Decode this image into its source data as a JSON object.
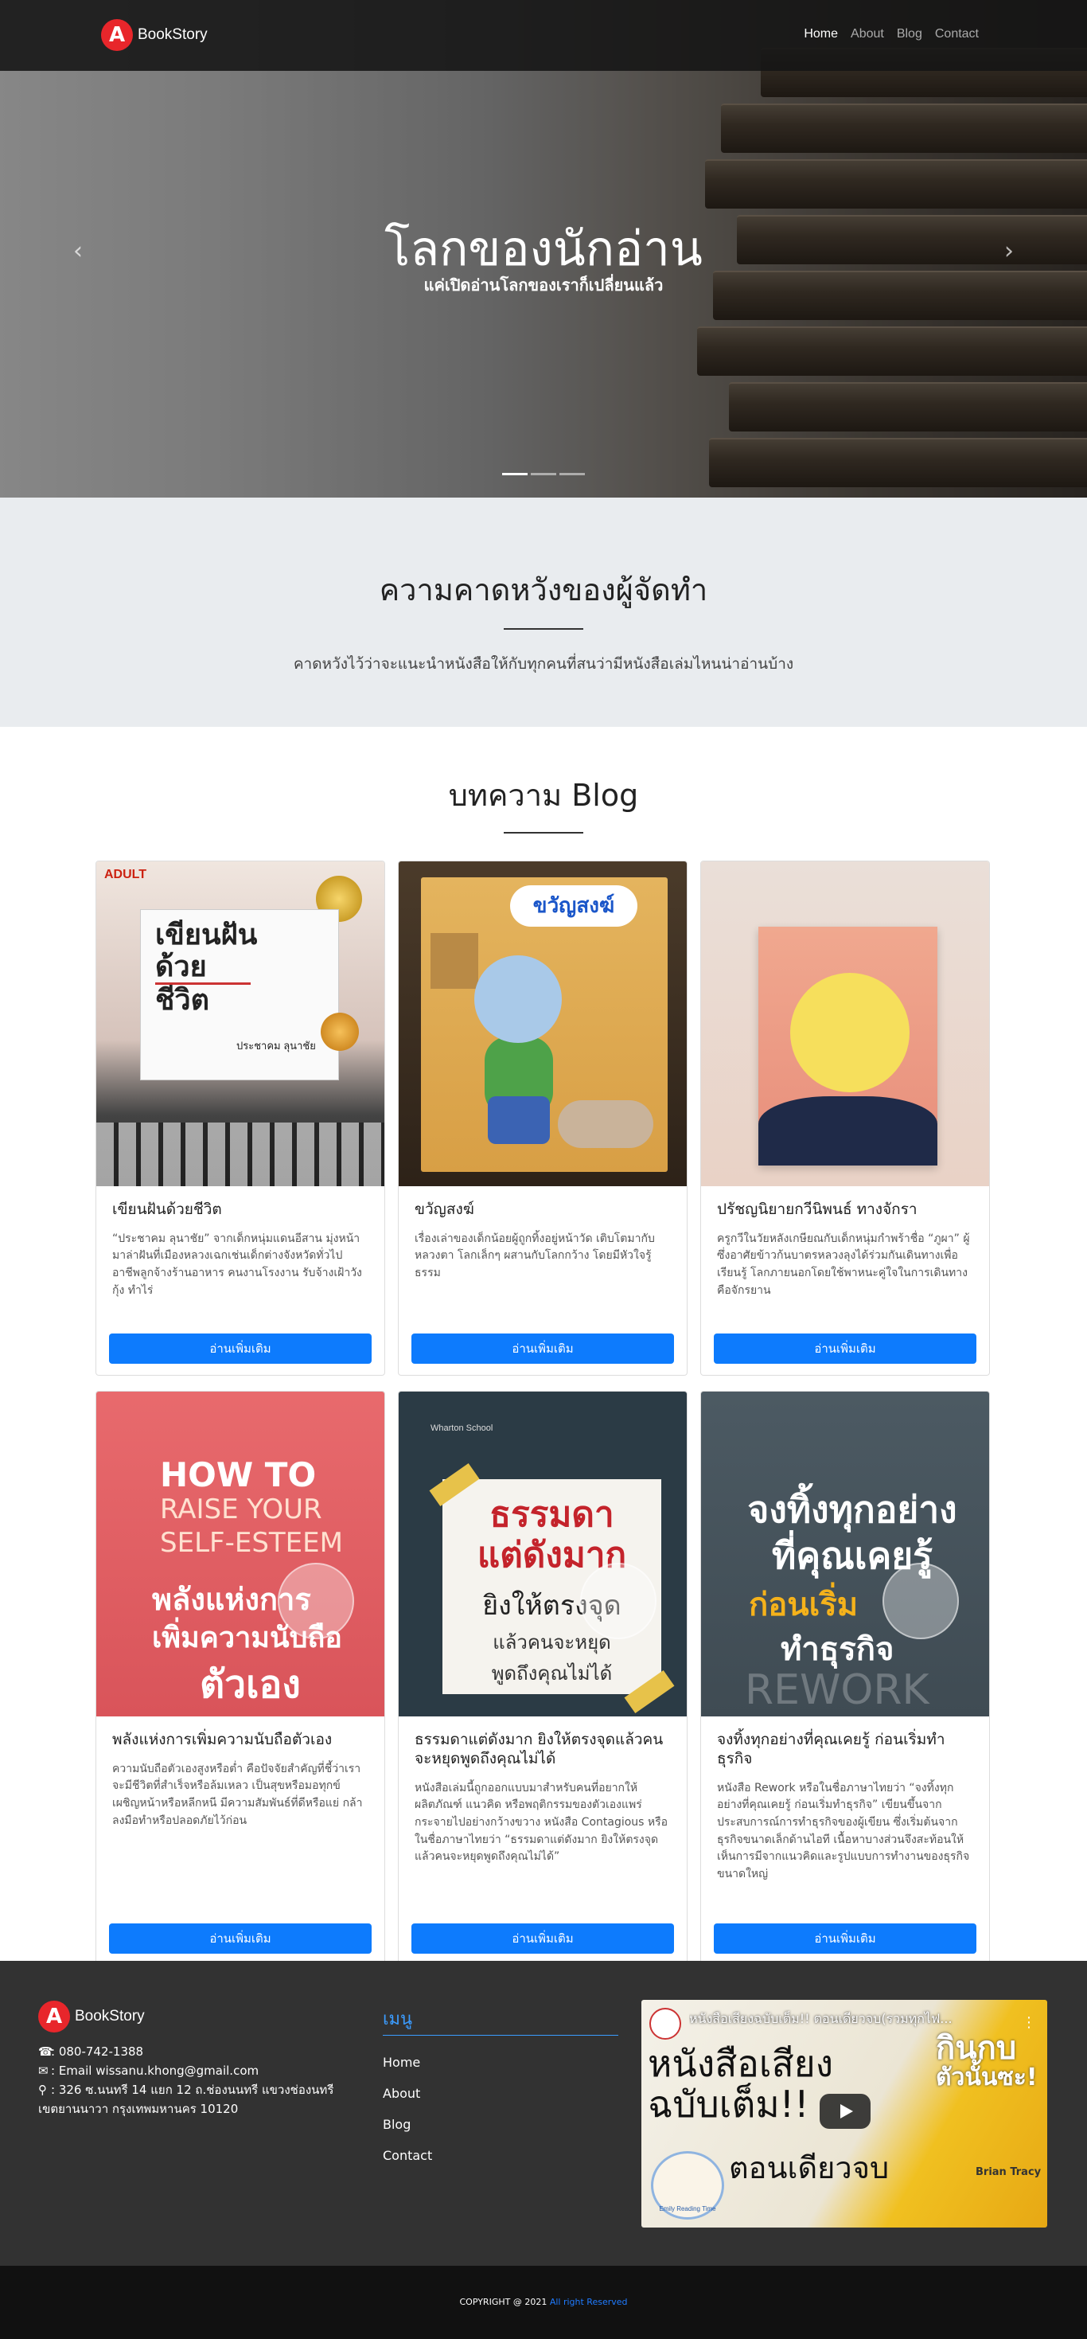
{
  "nav": {
    "brand_letter": "A",
    "brand": "BookStory",
    "links": [
      {
        "label": "Home",
        "active": true
      },
      {
        "label": "About",
        "active": false
      },
      {
        "label": "Blog",
        "active": false
      },
      {
        "label": "Contact",
        "active": false
      }
    ]
  },
  "hero": {
    "title": "โลกของนักอ่าน",
    "subtitle": "แค่เปิดอ่านโลกของเราก็เปลี่ยนแล้ว",
    "prev_icon": "‹",
    "next_icon": "›",
    "slide_count": 3,
    "active_slide": 1
  },
  "expect": {
    "title": "ความคาดหวังของผู้จัดทำ",
    "text": "คาดหวังไว้ว่าจะแนะนำหนังสือให้กับทุกคนที่สนว่ามีหนังสือเล่มไหนน่าอ่านบ้าง"
  },
  "blog": {
    "title": "บทความ Blog",
    "button_label": "อ่านเพิ่มเติม",
    "posts": [
      {
        "title": "เขียนฝันด้วยชีวิต",
        "text": "“ประชาคม ลุนาชัย” จากเด็กหนุ่มแดนอีสาน มุ่งหน้ามาล่าฝันที่เมืองหลวงเฉกเช่นเด็กต่างจังหวัดทั่วไป อาชีพลูกจ้างร้านอาหาร คนงานโรงงาน รับจ้างเฝ้าวังกุ้ง ทำไร่",
        "cover": {
          "tag": "ADULT",
          "line1": "เขียนฝัน",
          "line2": "ด้วย",
          "line3": "ชีวิต",
          "author": "ประชาคม ลุนาชัย"
        }
      },
      {
        "title": "ขวัญสงฆ์",
        "text": "เรื่องเล่าของเด็กน้อยผู้ถูกทิ้งอยู่หน้าวัด เติบโตมากับหลวงตา โลกเล็กๆ ผสานกับโลกกว้าง โดยมีหัวใจรู้ธรรม",
        "cover": {
          "ribbon": "ขวัญสงฆ์"
        }
      },
      {
        "title": "ปรัชญนิยายกวีนิพนธ์ ทางจักรา",
        "text": "ครูกวีในวัยหลังเกษียณกับเด็กหนุ่มกำพร้าชื่อ “ภูผา” ผู้ซึ่งอาศัยข้าวก้นบาตรหลวงลุงได้ร่วมกันเดินทางเพื่อเรียนรู้ โลกภายนอกโดยใช้พาหนะคู่ใจในการเดินทางคือจักรยาน",
        "cover": {}
      },
      {
        "title": "พลังแห่งการเพิ่มความนับถือตัวเอง",
        "text": "ความนับถือตัวเองสูงหรือต่ำ คือปัจจัยสำคัญที่ชี้ว่าเราจะมีชีวิตที่สำเร็จหรือล้มเหลว เป็นสุขหรือมอทุกข์ เผชิญหน้าหรือหลีกหนี มีความสัมพันธ์ที่ดีหรือแย่ กล้าลงมือทำหรือปลอดภัยไว้ก่อน",
        "cover": {
          "line1": "HOW TO",
          "line2": "RAISE YOUR",
          "line3": "SELF-ESTEEM",
          "line4": "พลังแห่งการ",
          "line5": "เพิ่มความนับถือ",
          "line6": "ตัวเอง"
        }
      },
      {
        "title": "ธรรมดาแต่ดังมาก ยิงให้ตรงจุดแล้วคนจะหยุดพูดถึงคุณไม่ได้",
        "text": "หนังสือเล่มนี้ถูกออกแบบมาสำหรับคนที่อยากให้ผลิตภัณฑ์ แนวคิด หรือพฤติกรรมของตัวเองแพร่กระจายไปอย่างกว้างขวาง หนังสือ Contagious หรือในชื่อภาษาไทยว่า “ธรรมดาแต่ดังมาก ยิงให้ตรงจุดแล้วคนจะหยุดพูดถึงคุณไม่ได้”",
        "cover": {
          "top": "Wharton School",
          "line1": "ธรรมดา",
          "line2": "แต่ดังมาก",
          "line3": "ยิงให้ตรงจุด",
          "line4": "แล้วคนจะหยุด",
          "line5": "พูดถึงคุณไม่ได้"
        }
      },
      {
        "title": "จงทิ้งทุกอย่างที่คุณเคยรู้ ก่อนเริ่มทำธุรกิจ",
        "text": "หนังสือ Rework หรือในชื่อภาษาไทยว่า “จงทิ้งทุกอย่างที่คุณเคยรู้ ก่อนเริ่มทำธุรกิจ” เขียนขึ้นจากประสบการณ์การทำธุรกิจของผู้เขียน ซึ่งเริ่มต้นจากธุรกิจขนาดเล็กด้านไอที เนื้อหาบางส่วนจึงสะท้อนให้เห็นการมีจากแนวคิดและรูปแบบการทำงานของธุรกิจขนาดใหญ่",
        "cover": {
          "line1": "จงทิ้งทุกอย่าง",
          "line2": "ที่คุณเคยรู้",
          "line3": "ก่อนเริ่ม",
          "line4": "ทำธุรกิจ",
          "line5": "REWORK"
        }
      }
    ]
  },
  "footer": {
    "brand_letter": "A",
    "brand": "BookStory",
    "phone_icon": "phone-icon",
    "phone": ": 080-742-1388",
    "email_icon": "envelope-icon",
    "email": ": Email wissanu.khong@gmail.com",
    "address_icon": "map-marker-icon",
    "address": ": 326 ซ.นนทรี 14 แยก 12 ถ.ช่องนนทรี แขวงช่องนทรี เขตยานนาวา กรุงเทพมหานคร 10120",
    "menu_title": "เมนู",
    "menu": [
      "Home",
      "About",
      "Blog",
      "Contact"
    ],
    "video": {
      "title": "หนังสือเสียงฉบับเต็ม!! ตอนเดียวจบ(รวมทุกไฟ...",
      "big_line1": "หนังสือเสียง",
      "big_line2": "ฉบับเต็ม!!",
      "mid": "ตอนเดียวจบ",
      "right1": "กินกบ",
      "right2": "ตัวนั้นซะ!",
      "brand_text": "Brian Tracy",
      "channel": "Emily Reading Time"
    },
    "copyright_prefix": "COPYRIGHT @ 2021 ",
    "copyright_link": "All right Reserved"
  },
  "colors": {
    "accent": "#0d7bfd",
    "brand_red": "#e8262b",
    "footer_bg": "#323232",
    "menu_blue": "#3b9cff"
  }
}
